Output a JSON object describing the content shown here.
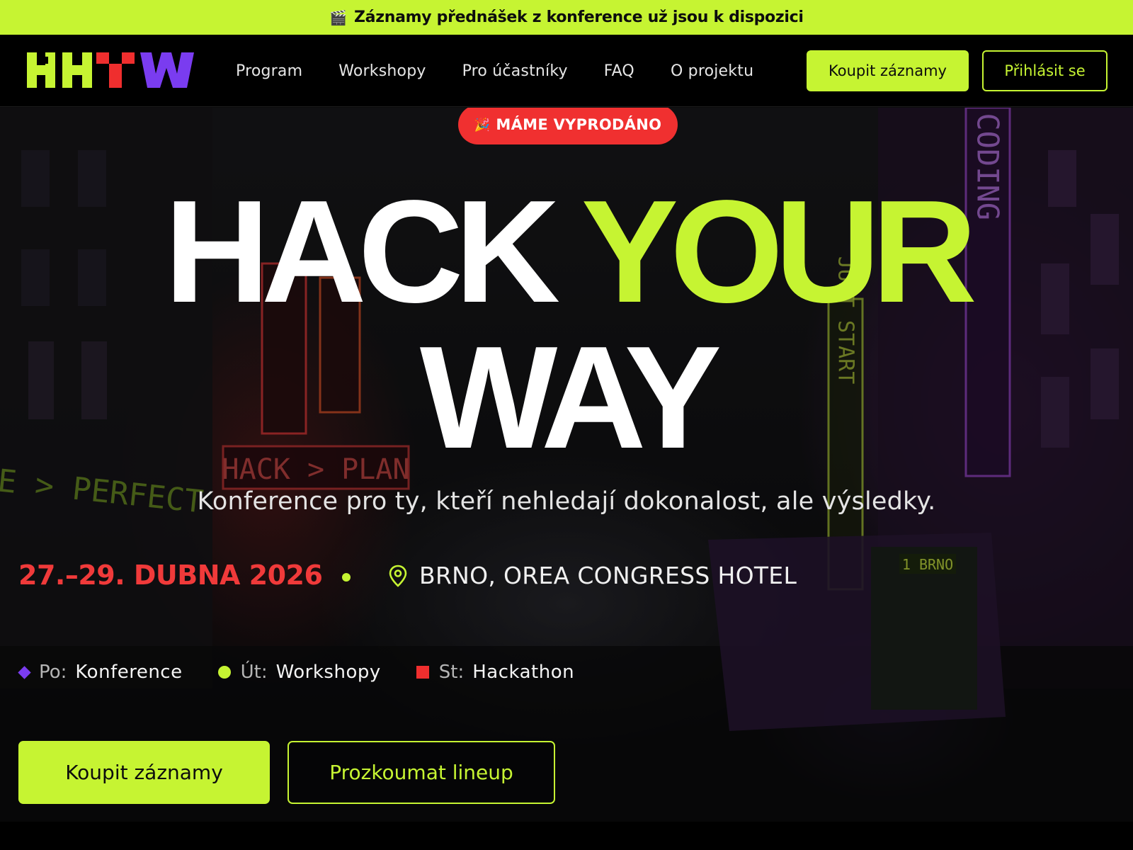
{
  "announcement": {
    "icon": "clapperboard-icon",
    "text": "Záznamy přednášek z konference už jsou k dispozici"
  },
  "header": {
    "nav": [
      "Program",
      "Workshopy",
      "Pro účastníky",
      "FAQ",
      "O projektu"
    ],
    "buy_label": "Koupit záznamy",
    "login_label": "Přihlásit se"
  },
  "hero": {
    "badge_icon": "party-popper-icon",
    "badge": "MÁME VYPRODÁNO",
    "headline_word1": "HACK",
    "headline_word2": "YOUR",
    "headline_word3": "WAY",
    "subtitle": "Konference pro ty, kteří nehledají dokonalost, ale výsledky.",
    "date": "27.–29. DUBNA 2026",
    "location": "BRNO, OREA CONGRESS HOTEL",
    "schedule": [
      {
        "day": "Po:",
        "value": "Konference",
        "color": "#7a3cf0"
      },
      {
        "day": "Út:",
        "value": "Workshopy",
        "color": "#c6f432"
      },
      {
        "day": "St:",
        "value": "Hackathon",
        "color": "#ef2e2e"
      }
    ],
    "primary_cta": "Koupit záznamy",
    "secondary_cta": "Prozkoumat lineup"
  },
  "background_signs": {
    "sign_left": "E > PERFECT",
    "sign_hack": "HACK > PLAN",
    "sign_just": "JUST START",
    "sign_vibe": "VIBE CODING",
    "tram_display": "1 BRNO"
  },
  "colors": {
    "accent": "#c6f432",
    "red": "#f03030",
    "purple": "#7a3cf0",
    "background": "#000000"
  }
}
